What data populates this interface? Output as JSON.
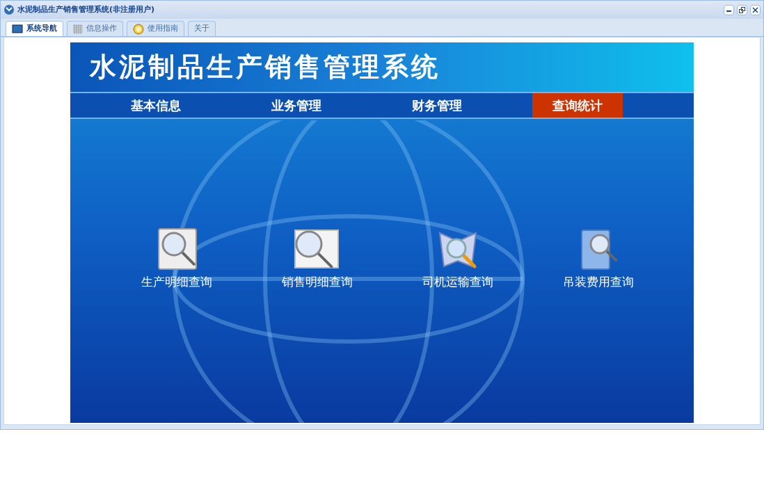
{
  "window": {
    "title": "水泥制品生产销售管理系统(非注册用户)"
  },
  "tabs": [
    {
      "label": "系统导航",
      "selected": true,
      "kind": "monitor"
    },
    {
      "label": "信息操作",
      "selected": false,
      "kind": "grid"
    },
    {
      "label": "使用指南",
      "selected": false,
      "kind": "help"
    },
    {
      "label": "关于",
      "selected": false,
      "kind": "none"
    }
  ],
  "banner": {
    "title": "水泥制品生产销售管理系统"
  },
  "menu": [
    {
      "label": "基本信息",
      "selected": false
    },
    {
      "label": "业务管理",
      "selected": false
    },
    {
      "label": "财务管理",
      "selected": false
    },
    {
      "label": "查询统计",
      "selected": true
    }
  ],
  "shortcuts": [
    {
      "label": "生产明细查询",
      "kind": "film"
    },
    {
      "label": "销售明细查询",
      "kind": "window"
    },
    {
      "label": "司机运输查询",
      "kind": "book"
    },
    {
      "label": "吊装费用查询",
      "kind": "files"
    }
  ]
}
